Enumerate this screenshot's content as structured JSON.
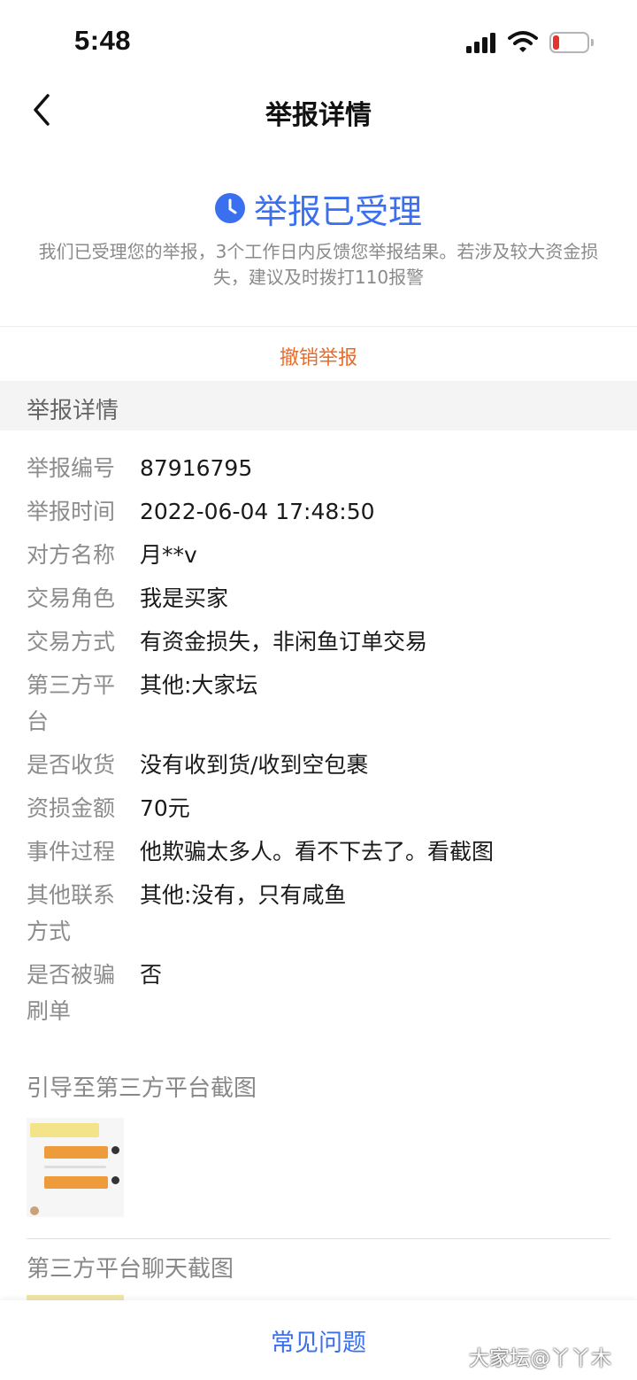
{
  "status_bar": {
    "time": "5:48"
  },
  "nav": {
    "title": "举报详情"
  },
  "status": {
    "title": "举报已受理",
    "description": "我们已受理您的举报，3个工作日内反馈您举报结果。若涉及较大资金损失，建议及时拨打110报警",
    "accent_color": "#3a6ff0"
  },
  "cancel": {
    "label": "撤销举报",
    "color": "#ec6a28"
  },
  "section": {
    "title": "举报详情"
  },
  "details": [
    {
      "label": "举报编号",
      "value": "87916795"
    },
    {
      "label": "举报时间",
      "value": "2022-06-04 17:48:50"
    },
    {
      "label": "对方名称",
      "value": "月**v"
    },
    {
      "label": "交易角色",
      "value": "我是买家"
    },
    {
      "label": "交易方式",
      "value": "有资金损失，非闲鱼订单交易"
    },
    {
      "label": "第三方平台",
      "value": "其他:大家坛"
    },
    {
      "label": "是否收货",
      "value": "没有收到货/收到空包裹"
    },
    {
      "label": "资损金额",
      "value": "70元"
    },
    {
      "label": "事件过程",
      "value": "他欺骗太多人。看不下去了。看截图"
    },
    {
      "label": "其他联系方式",
      "value": "其他:没有，只有咸鱼"
    },
    {
      "label": "是否被骗刷单",
      "value": "否"
    }
  ],
  "screenshots": {
    "guide_title": "引导至第三方平台截图",
    "chat_title": "第三方平台聊天截图"
  },
  "bottom": {
    "faq_label": "常见问题"
  },
  "watermark": "大家坛@丫丫木"
}
